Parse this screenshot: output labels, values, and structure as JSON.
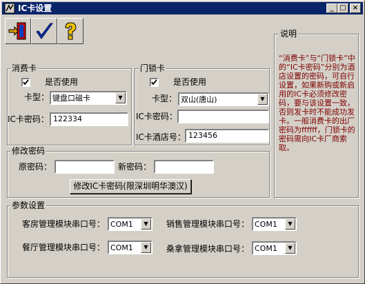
{
  "window": {
    "title": "IC卡设置"
  },
  "titlebar_buttons": {
    "minimize": "_",
    "maximize": "□",
    "close": "×"
  },
  "toolbar": [
    {
      "name": "exit-icon"
    },
    {
      "name": "checkmark-icon"
    },
    {
      "name": "help-icon"
    }
  ],
  "consume_card": {
    "group_label": "消费卡",
    "use_label": "是否使用",
    "use_checked": true,
    "type_label": "卡型：",
    "type_value": "键盘口磁卡",
    "pwd_label": "IC卡密码：",
    "pwd_value": "122334"
  },
  "lock_card": {
    "group_label": "门锁卡",
    "use_label": "是否使用",
    "use_checked": true,
    "type_label": "卡型：",
    "type_value": "双山(唐山)",
    "pwd_label": "IC卡密码：",
    "pwd_value": "",
    "hotel_label": "IC卡酒店号：",
    "hotel_value": "123456"
  },
  "change_pwd": {
    "group_label": "修改密码",
    "old_label": "原密码：",
    "old_value": "",
    "new_label": "新密码：",
    "new_value": "",
    "button_label": "修改IC卡密码(限深圳明华澳汉)"
  },
  "description": {
    "group_label": "说明",
    "text": "“消费卡”与“门锁卡”中的“IC卡密码”分别为酒店设置的密码，可自行设置，如果新购或新启用的IC卡必须修改密码，要与该设置一致，否则发卡时不能成功发卡。一般消费卡的出厂密码为ffffff，门锁卡的密码需向IC卡厂商索取。"
  },
  "params": {
    "group_label": "参数设置",
    "room_label": "客房管理模块串口号：",
    "room_value": "COM1",
    "sales_label": "销售管理模块串口号：",
    "sales_value": "COM1",
    "dining_label": "餐厅管理模块串口号：",
    "dining_value": "COM1",
    "sauna_label": "桑拿管理模块串口号：",
    "sauna_value": "COM1"
  }
}
